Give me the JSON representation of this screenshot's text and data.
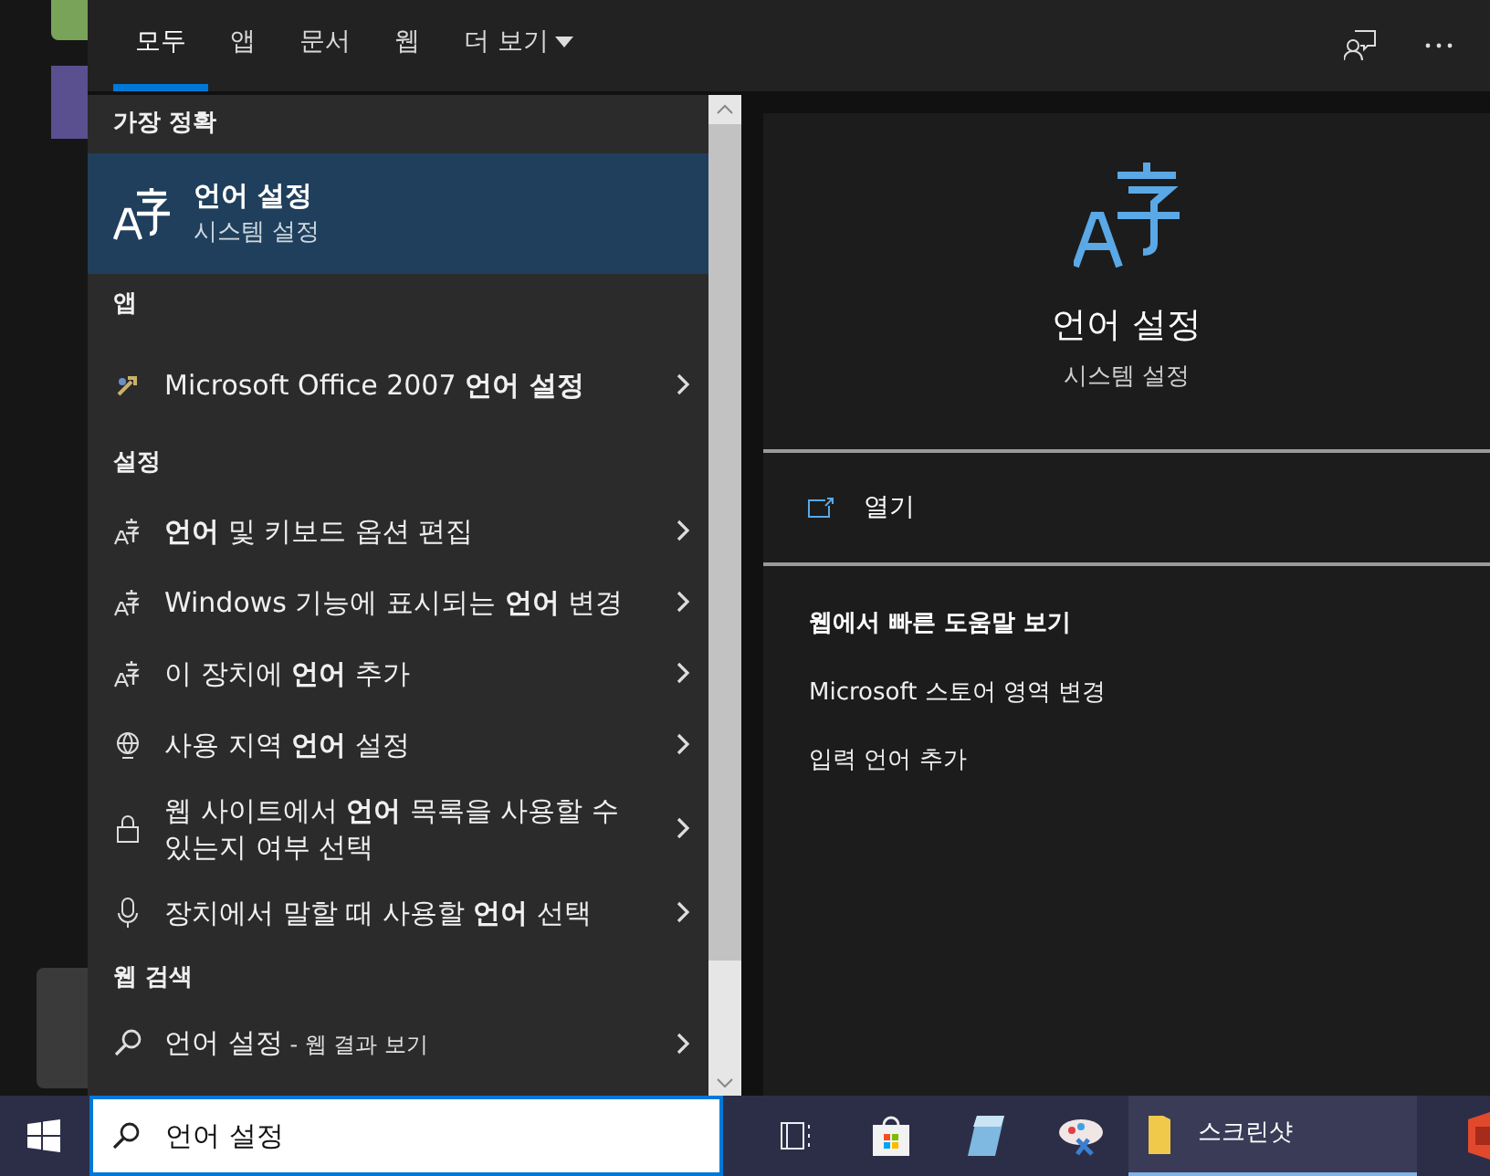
{
  "tabs": [
    {
      "label": "모두",
      "selected": true
    },
    {
      "label": "앱",
      "selected": false
    },
    {
      "label": "문서",
      "selected": false
    },
    {
      "label": "웹",
      "selected": false
    },
    {
      "label": "더 보기",
      "selected": false,
      "kind": "dropdown"
    }
  ],
  "results": [
    {
      "heading": "가장 정확",
      "items": [
        {
          "kind": "best",
          "title": "언어 설정",
          "subtitle": "시스템 설정",
          "selected": true
        }
      ]
    },
    {
      "heading": "앱",
      "items": [
        {
          "kind": "app",
          "title": "Microsoft Office 2007 **언어 설정**",
          "selected": false
        }
      ]
    },
    {
      "heading": "설정",
      "items": [
        {
          "kind": "language",
          "title": "**언어** 및 키보드 옵션 편집",
          "selected": false
        },
        {
          "kind": "language",
          "title": "Windows 기능에 표시되는 **언어** 변경",
          "selected": false
        },
        {
          "kind": "language",
          "title": "이 장치에 **언어** 추가",
          "selected": false
        },
        {
          "kind": "globe",
          "title": "사용 지역 **언어** 설정",
          "selected": false
        },
        {
          "kind": "lock",
          "title": "웹 사이트에서 **언어** 목록을 사용할 수 있는지 여부 선택",
          "selected": false
        },
        {
          "kind": "mic",
          "title": "장치에서 말할 때 사용할 **언어** 선택",
          "selected": false
        }
      ]
    },
    {
      "heading": "웹 검색",
      "items": [
        {
          "kind": "web",
          "title": "언어 설정",
          "suffix": "- 웹 결과 보기",
          "selected": false
        }
      ]
    }
  ],
  "preview": {
    "title": "언어 설정",
    "subtitle": "시스템 설정",
    "action": "열기",
    "help_heading": "웹에서 빠른 도움말 보기",
    "help_links": [
      "Microsoft 스토어 영역 변경",
      "입력 언어 추가"
    ]
  },
  "search": {
    "value": "언어 설정"
  },
  "taskbar": {
    "items": [
      {
        "kind": "taskview"
      },
      {
        "kind": "store"
      },
      {
        "kind": "notepad"
      },
      {
        "kind": "paint"
      },
      {
        "kind": "folder",
        "label": "스크린샷",
        "selected": true
      },
      {
        "kind": "office"
      }
    ]
  }
}
